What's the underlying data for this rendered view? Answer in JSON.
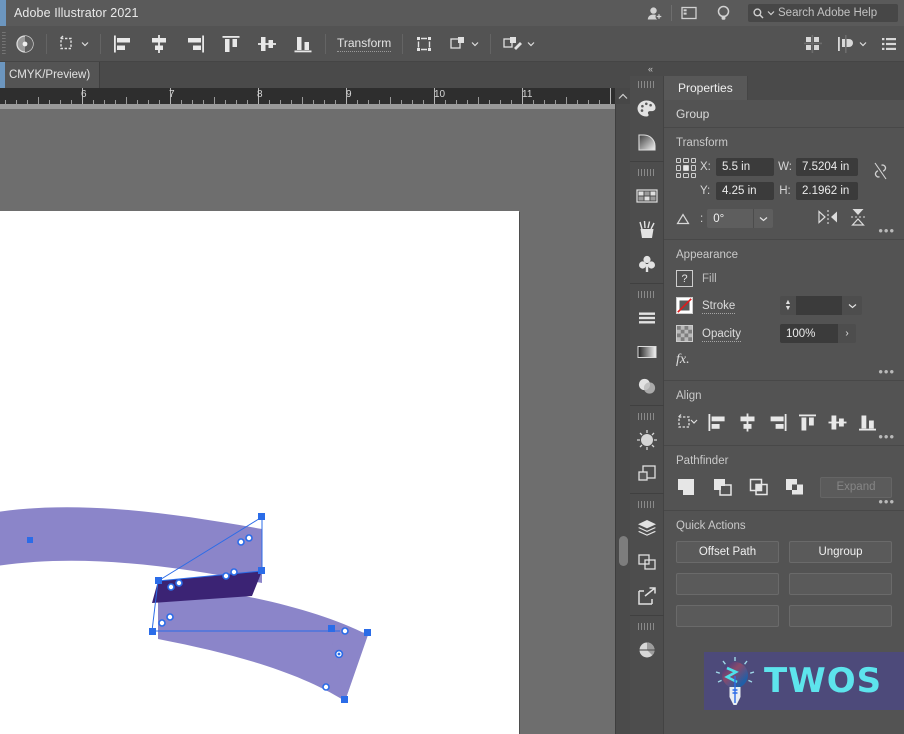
{
  "titlebar": {
    "app_title": "Adobe Illustrator 2021",
    "icons": [
      {
        "name": "add-user-icon",
        "glyph": "person-plus"
      },
      {
        "name": "workspace-icon",
        "glyph": "panel"
      },
      {
        "name": "help-bulb-icon",
        "glyph": "bulb"
      }
    ],
    "search": {
      "placeholder": "Search Adobe Help",
      "icon": "search-icon",
      "caret": "chevron-down-icon"
    }
  },
  "controlbar": {
    "items": [
      {
        "name": "selection-color-swatch",
        "label": ""
      },
      {
        "name": "transform-shape-dropdown",
        "label": ""
      },
      {
        "name": "align-left-button",
        "label": ""
      },
      {
        "name": "align-horizontal-center-button",
        "label": ""
      },
      {
        "name": "align-right-button",
        "label": ""
      },
      {
        "name": "align-top-button",
        "label": ""
      },
      {
        "name": "align-vertical-center-button",
        "label": ""
      },
      {
        "name": "align-bottom-button",
        "label": ""
      }
    ],
    "transform_label": "Transform",
    "right_items": [
      {
        "name": "arrange-grid-button"
      },
      {
        "name": "distribute-button"
      },
      {
        "name": "panel-list-button"
      }
    ]
  },
  "document": {
    "tab_label": "CMYK/Preview)"
  },
  "ruler": {
    "unit": "in",
    "labels": [
      "6",
      "7",
      "8",
      "9",
      "10",
      "11"
    ],
    "label_positions": [
      78,
      166,
      254,
      343,
      431,
      519
    ]
  },
  "artwork": {
    "description": "ribbon-banner-shape",
    "fill_color": "#8b85c9",
    "fold_color": "#3b2374",
    "selection_color": "#2b6ce8",
    "anchor_color": "#2b6ce8"
  },
  "rail": {
    "groups": [
      [
        "color-palette-icon",
        "gradient-icon"
      ],
      [
        "swatches-icon",
        "brushes-icon",
        "symbols-icon"
      ],
      [
        "align-panel-icon",
        "gradient-panel-icon",
        "transparency-icon"
      ],
      [
        "stroke-panel-icon",
        "artboards-icon"
      ],
      [
        "layers-icon",
        "pathfinder-icon",
        "export-icon"
      ],
      [
        "libraries-icon"
      ]
    ]
  },
  "properties": {
    "collapse_label": "«",
    "tab_label": "Properties",
    "object_type": "Group",
    "transform": {
      "section_title": "Transform",
      "x_label": "X:",
      "x_value": "5.5 in",
      "y_label": "Y:",
      "y_value": "4.25 in",
      "w_label": "W:",
      "w_value": "7.5204 in",
      "h_label": "H:",
      "h_value": "2.1962 in",
      "angle_label": "angle-icon",
      "angle_value": "0°",
      "link_icon": "broken-link-icon",
      "flip_h_icon": "flip-horizontal-icon",
      "flip_v_icon": "flip-vertical-icon",
      "more_options": "•••"
    },
    "appearance": {
      "section_title": "Appearance",
      "fill_label": "Fill",
      "fill_swatch": "question-mark-swatch",
      "stroke_label": "Stroke",
      "stroke_swatch": "none-stroke-swatch",
      "stroke_value": "",
      "opacity_label": "Opacity",
      "opacity_value": "100%",
      "fx_label": "fx.",
      "more_options": "•••"
    },
    "align": {
      "section_title": "Align",
      "buttons": [
        "align-to-selection-dropdown",
        "align-left-button",
        "align-horizontal-center-button",
        "align-right-button",
        "align-top-button",
        "align-vertical-center-button",
        "align-bottom-button"
      ],
      "more_options": "•••"
    },
    "pathfinder": {
      "section_title": "Pathfinder",
      "buttons": [
        "unite-button",
        "minus-front-button",
        "intersect-button",
        "exclude-button"
      ],
      "expand_label": "Expand",
      "more_options": "•••"
    },
    "quick_actions": {
      "section_title": "Quick Actions",
      "buttons": [
        "Offset Path",
        "Ungroup"
      ]
    }
  },
  "watermark": {
    "text": "TWOS",
    "icon": "lightbulb-icon",
    "bg_color": "#4d4a7a",
    "text_color": "#5de4ec"
  }
}
